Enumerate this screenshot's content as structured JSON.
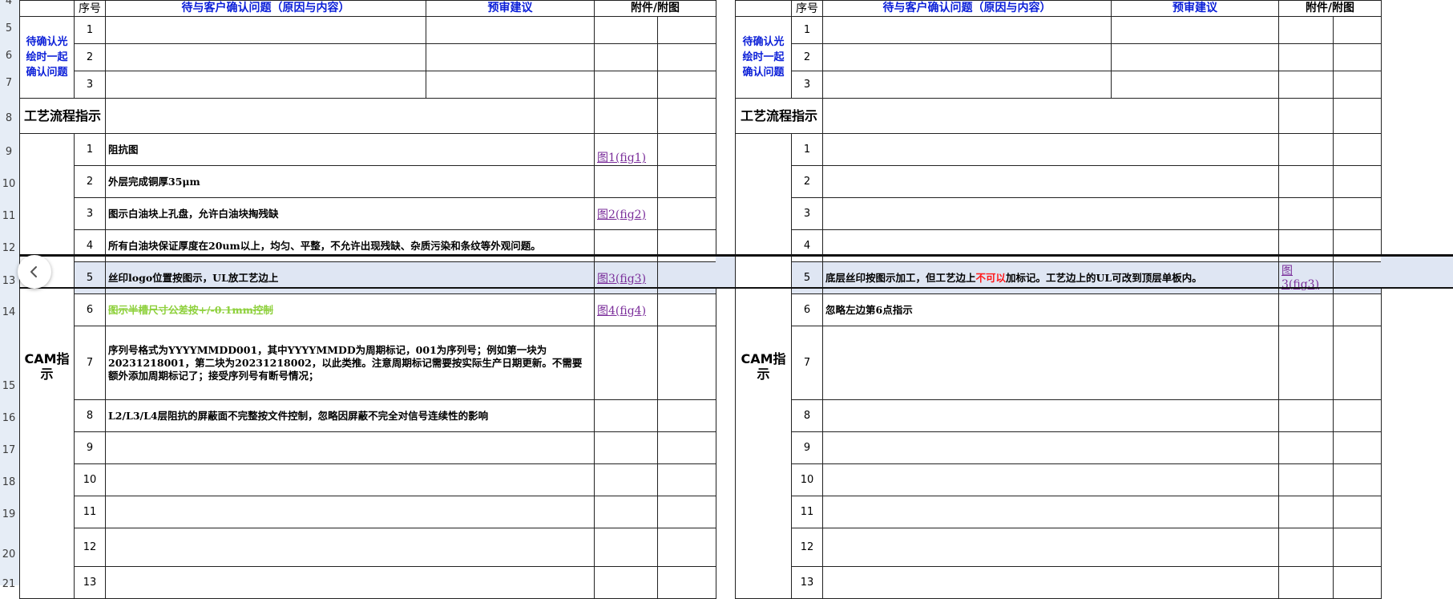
{
  "row_headers": [
    "4",
    "5",
    "6",
    "7",
    "8",
    "9",
    "10",
    "11",
    "12",
    "13",
    "14",
    "15",
    "16",
    "17",
    "18",
    "19",
    "20",
    "21"
  ],
  "left": {
    "header_cut": [
      "序号",
      "待与客户确认问题（原因与内容）",
      "预审建议",
      "附件/附图"
    ],
    "pending_label": "待确认光绘时一起确认问题",
    "pending_rows": [
      "1",
      "2",
      "3"
    ],
    "process_label": "工艺流程指示",
    "cam_label": "CAM指示",
    "cam_rows": [
      {
        "no": "1",
        "text": "阻抗图",
        "link": "图1(fig1)"
      },
      {
        "no": "2",
        "text": "外层完成铜厚35μm",
        "link": ""
      },
      {
        "no": "3",
        "text": "图示白油块上孔盘，允许白油块掏残缺",
        "link": "图2(fig2)"
      },
      {
        "no": "4",
        "text": "所有白油块保证厚度在20um以上，均匀、平整，不允许出现残缺、杂质污染和条纹等外观问题。",
        "link": ""
      },
      {
        "no": "5",
        "text": "丝印logo位置按图示，UL放工艺边上",
        "link": "图3(fig3)"
      },
      {
        "no": "6",
        "text": "图示半槽尺寸公差按+/-0.1mm控制",
        "link": "图4(fig4)"
      },
      {
        "no": "7",
        "text": "序列号格式为YYYYMMDD001，其中YYYYMMDD为周期标记，001为序列号；例如第一块为20231218001，第二块为20231218002，以此类推。注意周期标记需要按实际生产日期更新。不需要额外添加周期标记了；接受序列号有断号情况；",
        "link": ""
      },
      {
        "no": "8",
        "text": "L2/L3/L4层阻抗的屏蔽面不完整按文件控制，忽略因屏蔽不完全对信号连续性的影响",
        "link": ""
      },
      {
        "no": "9",
        "text": "",
        "link": ""
      },
      {
        "no": "10",
        "text": "",
        "link": ""
      },
      {
        "no": "11",
        "text": "",
        "link": ""
      },
      {
        "no": "12",
        "text": "",
        "link": ""
      },
      {
        "no": "13",
        "text": "",
        "link": ""
      }
    ]
  },
  "right": {
    "header_cut": [
      "序号",
      "待与客户确认问题（原因与内容）",
      "预审建议",
      "附件/附图"
    ],
    "pending_label": "待确认光绘时一起确认问题",
    "pending_rows": [
      "1",
      "2",
      "3"
    ],
    "process_label": "工艺流程指示",
    "cam_label": "CAM指示",
    "cam_rows": [
      {
        "no": "1",
        "text": ""
      },
      {
        "no": "2",
        "text": ""
      },
      {
        "no": "3",
        "text": ""
      },
      {
        "no": "4",
        "text": ""
      },
      {
        "no": "5",
        "text_before": "底层丝印按图示加工，但工艺边上",
        "text_red": "不可以",
        "text_after": "加标记。工艺边上的UL可改到顶层单板内。",
        "link": "图3(fig3)"
      },
      {
        "no": "6",
        "text": "忽略左边第6点指示"
      },
      {
        "no": "7",
        "text": ""
      },
      {
        "no": "8",
        "text": ""
      },
      {
        "no": "9",
        "text": ""
      },
      {
        "no": "10",
        "text": ""
      },
      {
        "no": "11",
        "text": ""
      },
      {
        "no": "12",
        "text": ""
      },
      {
        "no": "13",
        "text": ""
      }
    ]
  },
  "colors": {
    "label_blue": "#0b1fd8",
    "link_purple": "#7a2d9a",
    "strike_green": "#8fd13e",
    "warning_red": "#ff1a1a",
    "selection": "#dfe6f3"
  },
  "icons": {
    "nav": "chevron-left-icon"
  }
}
